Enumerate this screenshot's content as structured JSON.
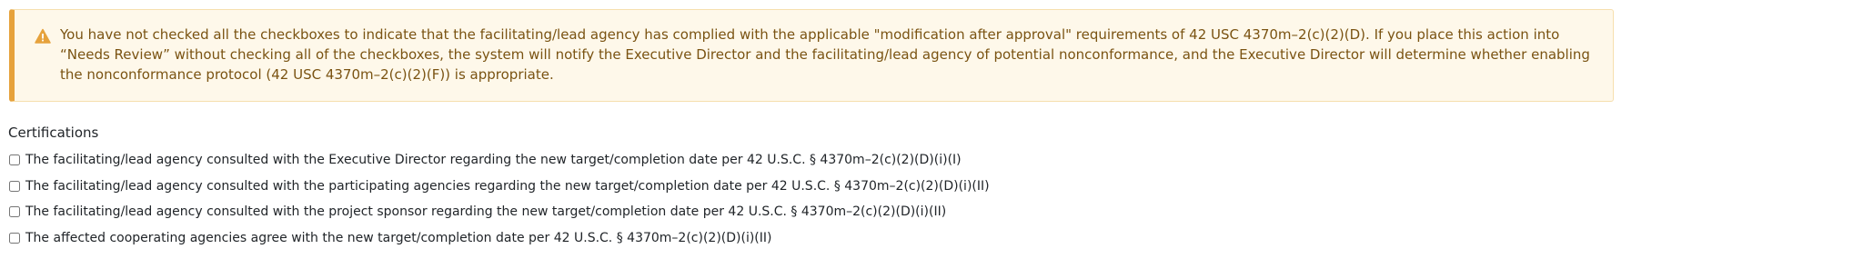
{
  "alert": {
    "icon": "warning-triangle-icon",
    "accent_color": "#e6a23c",
    "message": "You have not checked all the checkboxes to indicate that the facilitating/lead agency has complied with the applicable \"modification after approval\" requirements of 42 USC 4370m–2(c)(2)(D). If you place this action into “Needs Review” without checking all of the checkboxes, the system will notify the Executive Director and the facilitating/lead agency of potential nonconformance, and the Executive Director will determine whether enabling the nonconformance protocol (42 USC 4370m–2(c)(2)(F)) is appropriate."
  },
  "certifications": {
    "title": "Certifications",
    "items": [
      {
        "label": "The facilitating/lead agency consulted with the Executive Director regarding the new target/completion date per 42 U.S.C. § 4370m–2(c)(2)(D)(i)(I)",
        "checked": false
      },
      {
        "label": "The facilitating/lead agency consulted with the participating agencies regarding the new target/completion date per 42 U.S.C. § 4370m–2(c)(2)(D)(i)(II)",
        "checked": false
      },
      {
        "label": "The facilitating/lead agency consulted with the project sponsor regarding the new target/completion date per 42 U.S.C. § 4370m–2(c)(2)(D)(i)(II)",
        "checked": false
      },
      {
        "label": "The affected cooperating agencies agree with the new target/completion date per 42 U.S.C. § 4370m–2(c)(2)(D)(i)(II)",
        "checked": false
      }
    ]
  }
}
